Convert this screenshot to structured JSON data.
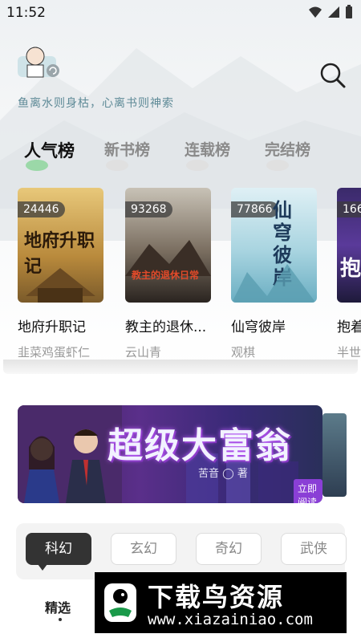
{
  "status_bar": {
    "time": "11:52"
  },
  "header": {
    "slogan": "鱼离水则身枯，心离书则神索"
  },
  "rank_tabs": [
    "人气榜",
    "新书榜",
    "连载榜",
    "完结榜"
  ],
  "books": [
    {
      "count": "24446",
      "title": "地府升职记",
      "author": "韭菜鸡蛋虾仁",
      "cover_text": "地府升职记"
    },
    {
      "count": "93268",
      "title": "教主的退休...",
      "author": "云山青",
      "cover_text": "教主的退休日常"
    },
    {
      "count": "77866",
      "title": "仙穹彼岸",
      "author": "观棋",
      "cover_text": "仙穹彼岸"
    },
    {
      "count": "166",
      "title": "抱着",
      "author": "半世",
      "cover_text": "抱"
    }
  ],
  "banner": {
    "title": "超级大富翁",
    "author": "苦音 ◯ 著",
    "button": "立即阅读"
  },
  "genres": [
    "科幻",
    "玄幻",
    "奇幻",
    "武侠"
  ],
  "sub_tab": "精选",
  "watermark": {
    "title": "下载鸟资源",
    "url": "www.xiazainiao.com"
  },
  "colors": {
    "slogan": "#5e8a97",
    "active_genre": "#333333",
    "banner_accent": "#8a3fd6"
  }
}
